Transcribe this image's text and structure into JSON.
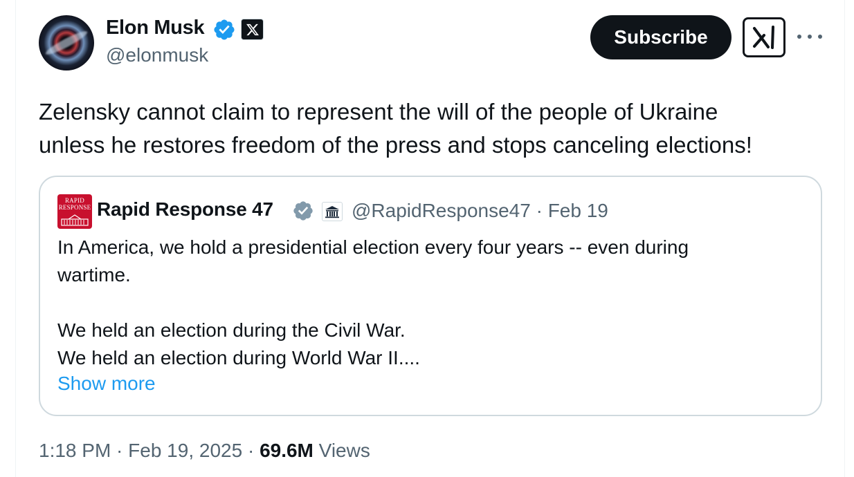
{
  "author": {
    "name": "Elon Musk",
    "handle": "@elonmusk"
  },
  "actions": {
    "subscribe_label": "Subscribe"
  },
  "tweet": {
    "text_lines": [
      "Zelensky cannot claim to represent the will of the people of Ukraine",
      "unless he restores freedom of the press and stops canceling elections!"
    ]
  },
  "quoted": {
    "avatar_line1": "RAPID",
    "avatar_line2": "RESPONSE",
    "name": "Rapid Response 47",
    "handle_date": "@RapidResponse47 · Feb 19",
    "lines": [
      "In America, we hold a presidential election every four years -- even during",
      "wartime.",
      "",
      "We held an election during the Civil War.",
      "We held an election during World War II...."
    ],
    "show_more": "Show more"
  },
  "meta": {
    "time_date": "1:18 PM · Feb 19, 2025 · ",
    "views_count": "69.6M",
    "views_label": " Views"
  },
  "colors": {
    "verified_blue": "#1d9bf0",
    "gov_gray": "#829aab",
    "text_primary": "#0f1419",
    "text_secondary": "#536471",
    "brand_red": "#c8102e"
  },
  "icons": [
    "verified-badge-icon",
    "x-logo-icon",
    "grok-icon",
    "more-icon",
    "government-badge-icon"
  ]
}
